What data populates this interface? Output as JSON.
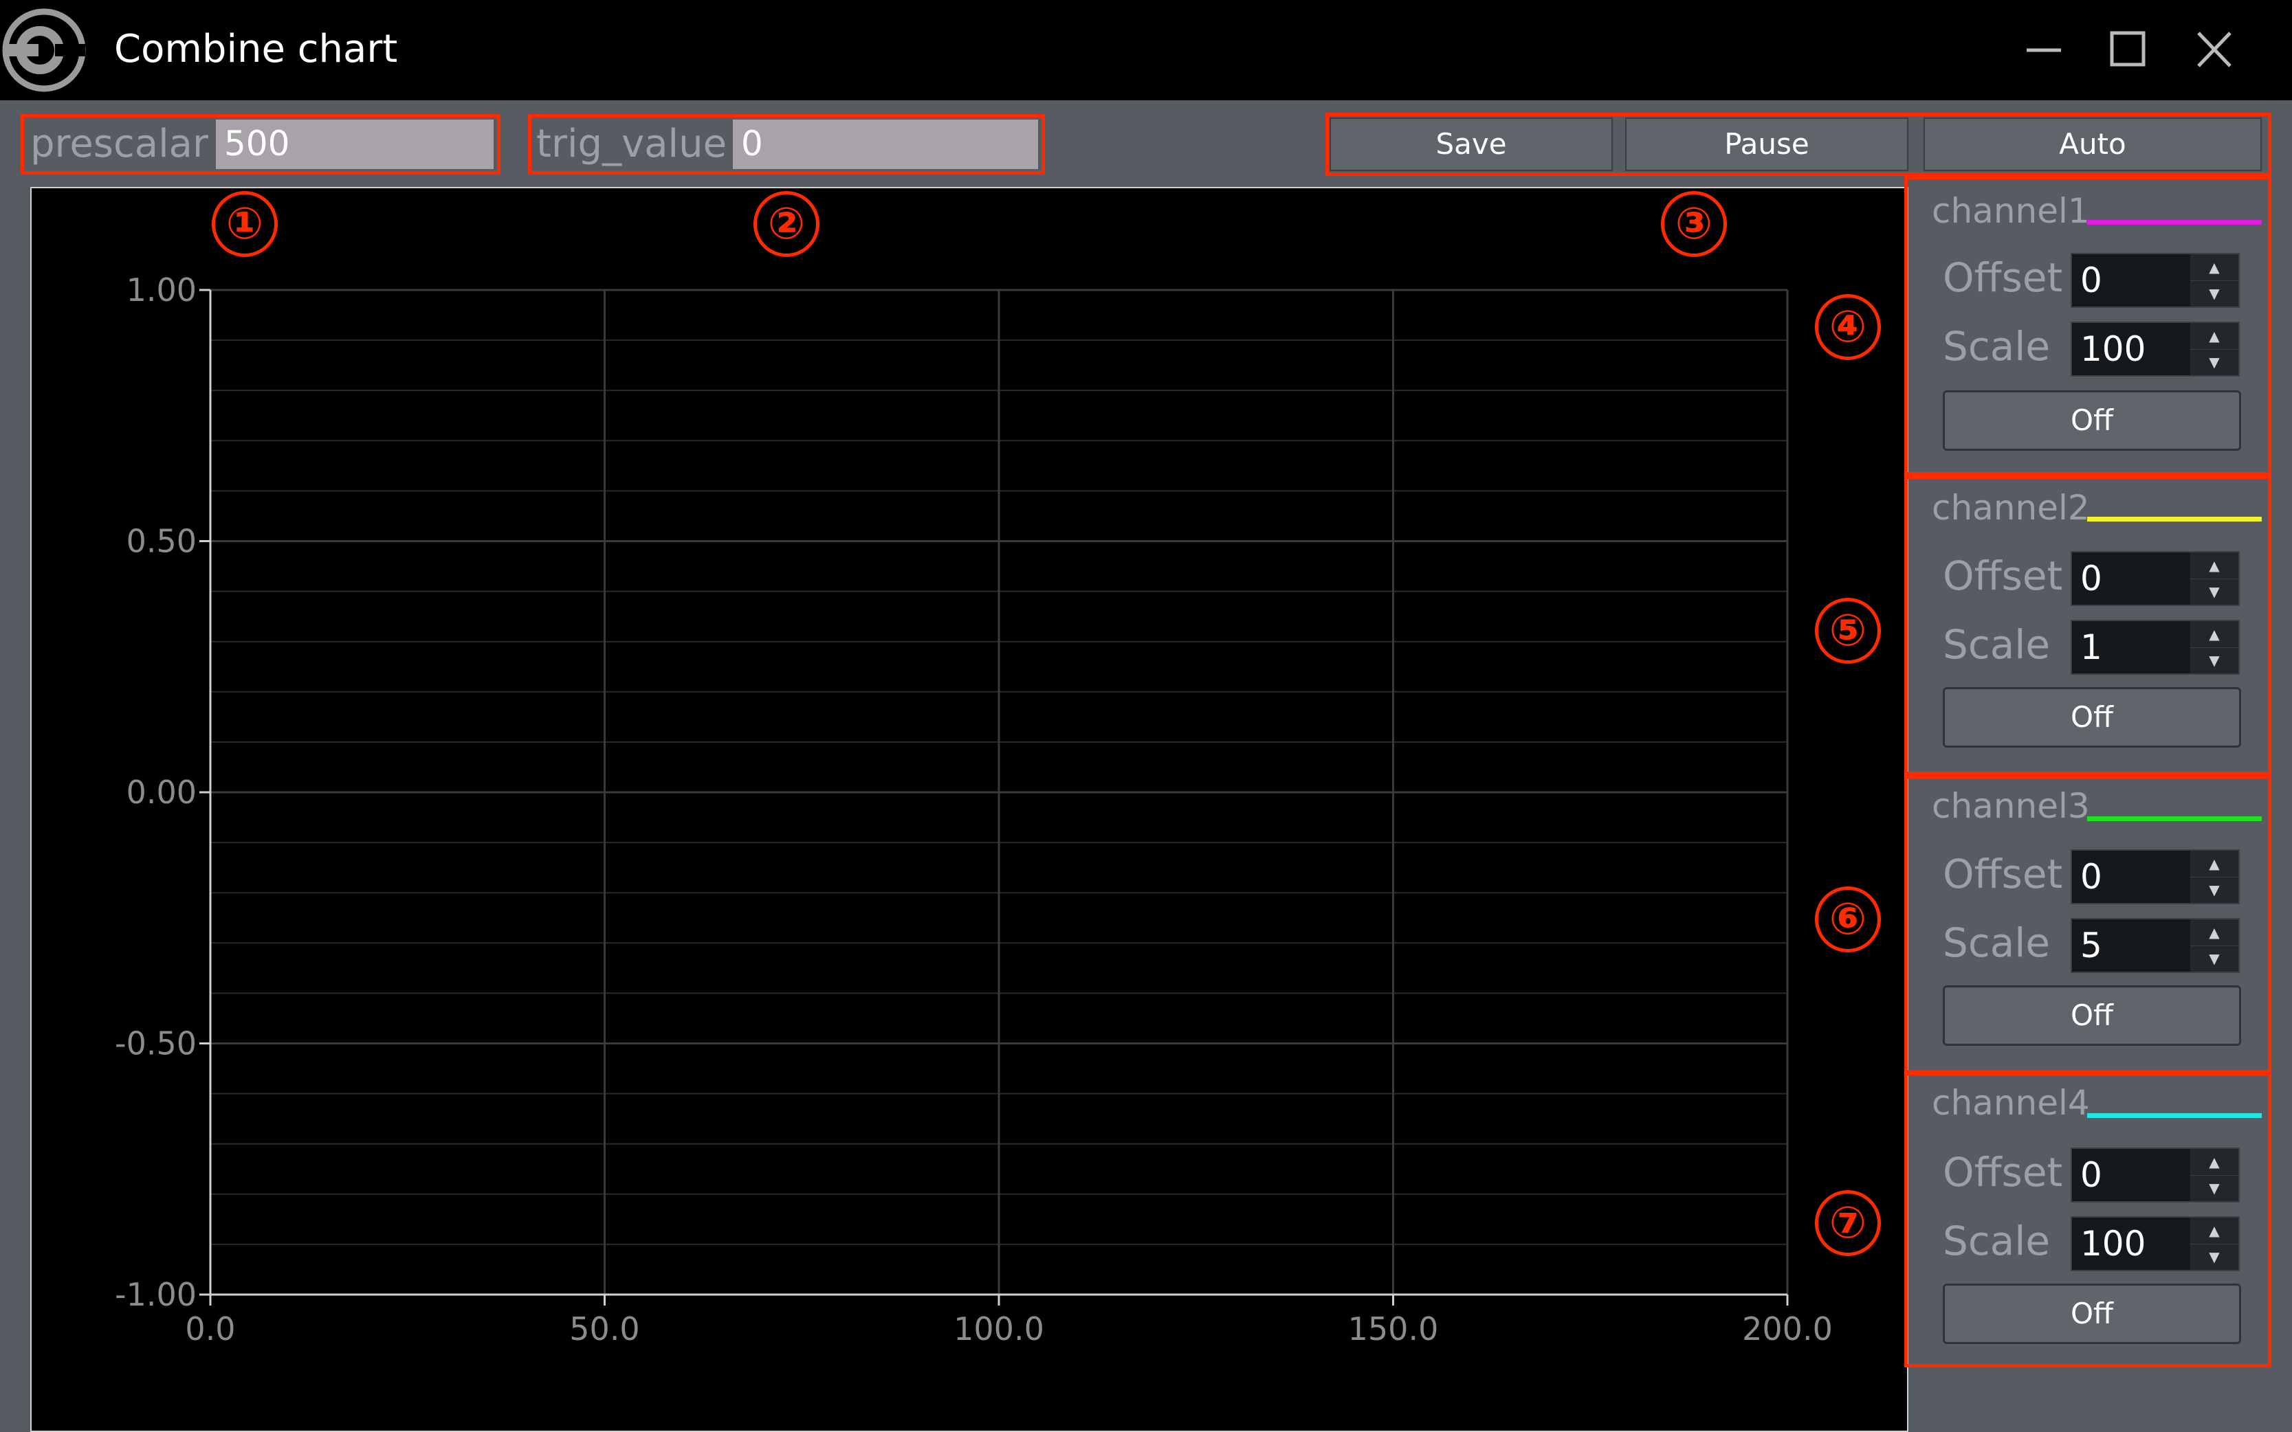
{
  "window": {
    "title": "Combine chart",
    "minimize_icon": "minimize-icon",
    "maximize_icon": "maximize-icon",
    "close_icon": "close-icon",
    "app_icon": "app-logo-icon"
  },
  "toolbar": {
    "prescalar_label": "prescalar",
    "prescalar_value": "500",
    "trig_label": "trig_value",
    "trig_value": "0",
    "save_label": "Save",
    "pause_label": "Pause",
    "auto_label": "Auto"
  },
  "annotations": [
    "①",
    "②",
    "③",
    "④",
    "⑤",
    "⑥",
    "⑦"
  ],
  "colors": {
    "annotation": "#ff2b00",
    "channel1": "#e21ce2",
    "channel2": "#f2f22a",
    "channel3": "#22e022",
    "channel4": "#22e6e6"
  },
  "channels": [
    {
      "name": "channel1",
      "offset_label": "Offset",
      "offset": "0",
      "scale_label": "Scale",
      "scale": "100",
      "button": "Off",
      "color": "#e21ce2"
    },
    {
      "name": "channel2",
      "offset_label": "Offset",
      "offset": "0",
      "scale_label": "Scale",
      "scale": "1",
      "button": "Off",
      "color": "#f2f22a"
    },
    {
      "name": "channel3",
      "offset_label": "Offset",
      "offset": "0",
      "scale_label": "Scale",
      "scale": "5",
      "button": "Off",
      "color": "#22e022"
    },
    {
      "name": "channel4",
      "offset_label": "Offset",
      "offset": "0",
      "scale_label": "Scale",
      "scale": "100",
      "button": "Off",
      "color": "#22e6e6"
    }
  ],
  "chart_data": {
    "type": "line",
    "title": "",
    "xlabel": "",
    "ylabel": "",
    "xlim": [
      0,
      200
    ],
    "ylim": [
      -1,
      1
    ],
    "x_ticks": [
      "0.0",
      "50.0",
      "100.0",
      "150.0",
      "200.0"
    ],
    "y_ticks": [
      "1.00",
      "0.50",
      "0.00",
      "-0.50",
      "-1.00"
    ],
    "x_tick_values": [
      0,
      50,
      100,
      150,
      200
    ],
    "y_tick_values": [
      1,
      0.5,
      0,
      -0.5,
      -1
    ],
    "grid": true,
    "series": []
  }
}
